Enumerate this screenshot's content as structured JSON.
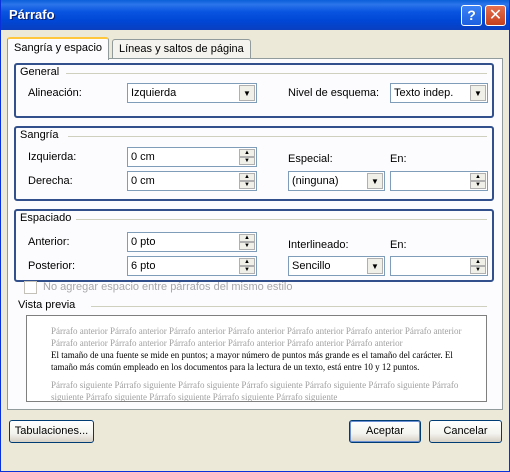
{
  "window": {
    "title": "Párrafo"
  },
  "titlebar_buttons": {
    "help": "?",
    "close": "✕"
  },
  "tabs": [
    {
      "label": "Sangría y espacio",
      "active": true
    },
    {
      "label": "Líneas y saltos de página",
      "active": false
    }
  ],
  "general": {
    "title": "General",
    "alignment_label": "Alineación:",
    "alignment_value": "Izquierda",
    "outline_label": "Nivel de esquema:",
    "outline_value": "Texto indep."
  },
  "indent": {
    "title": "Sangría",
    "left_label": "Izquierda:",
    "left_value": "0 cm",
    "right_label": "Derecha:",
    "right_value": "0 cm",
    "special_label": "Especial:",
    "special_value": "(ninguna)",
    "by_label": "En:",
    "by_value": ""
  },
  "spacing": {
    "title": "Espaciado",
    "before_label": "Anterior:",
    "before_value": "0 pto",
    "after_label": "Posterior:",
    "after_value": "6 pto",
    "line_spacing_label": "Interlineado:",
    "line_spacing_value": "Sencillo",
    "at_label": "En:",
    "at_value": ""
  },
  "no_space_checkbox": {
    "label": "No agregar espacio entre párrafos del mismo estilo",
    "checked": false,
    "enabled": false
  },
  "preview": {
    "title": "Vista previa",
    "previous_text": "Párrafo anterior Párrafo anterior Párrafo anterior Párrafo anterior Párrafo anterior Párrafo anterior Párrafo anterior Párrafo anterior Párrafo anterior Párrafo anterior Párrafo anterior Párrafo anterior Párrafo anterior",
    "main_text": "El tamaño de una fuente se mide en puntos; a mayor número de puntos más grande es el tamaño del carácter. El tamaño más común empleado en los documentos para la lectura de un texto, está entre 10 y 12 puntos.",
    "next_text": "Párrafo siguiente Párrafo siguiente Párrafo siguiente Párrafo siguiente Párrafo siguiente Párrafo siguiente Párrafo siguiente Párrafo siguiente Párrafo siguiente Párrafo siguiente Párrafo siguiente"
  },
  "buttons": {
    "tabs": "Tabulaciones...",
    "accept": "Aceptar",
    "cancel": "Cancelar"
  },
  "icons": {
    "dropdown": "chevron-down-icon",
    "spin_up": "spin-up-icon",
    "spin_down": "spin-down-icon"
  },
  "colors": {
    "title_bar": "#0054e3",
    "group_highlight": "#32508c",
    "dialog_bg": "#ece9d8",
    "panel_bg": "#fcfcfe"
  }
}
